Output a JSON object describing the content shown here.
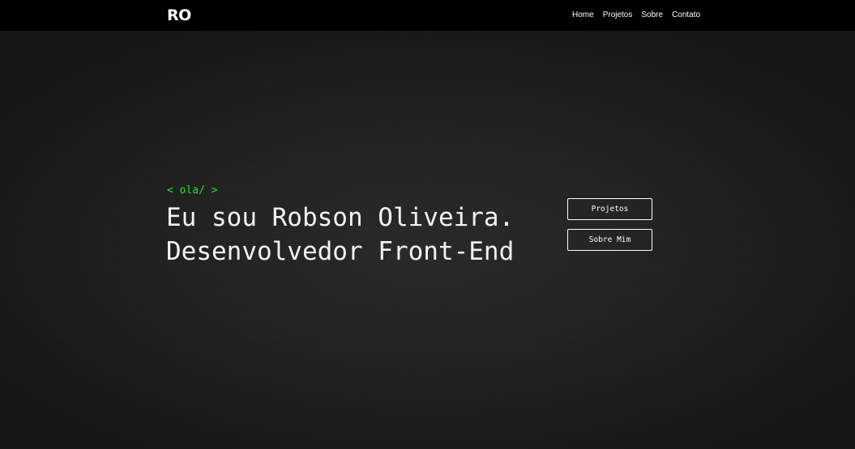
{
  "header": {
    "logo": "RO",
    "nav": [
      "Home",
      "Projetos",
      "Sobre",
      "Contato"
    ]
  },
  "hero": {
    "tag": "< ola/ >",
    "line1": "Eu sou Robson Oliveira.",
    "line2": "Desenvolvedor Front-End",
    "buttons": {
      "projetos": "Projetos",
      "sobre_mim": "Sobre Mim"
    }
  },
  "colors": {
    "accent_green": "#22e22a",
    "background": "#222222",
    "navbar": "#000000",
    "text": "#ffffff"
  }
}
